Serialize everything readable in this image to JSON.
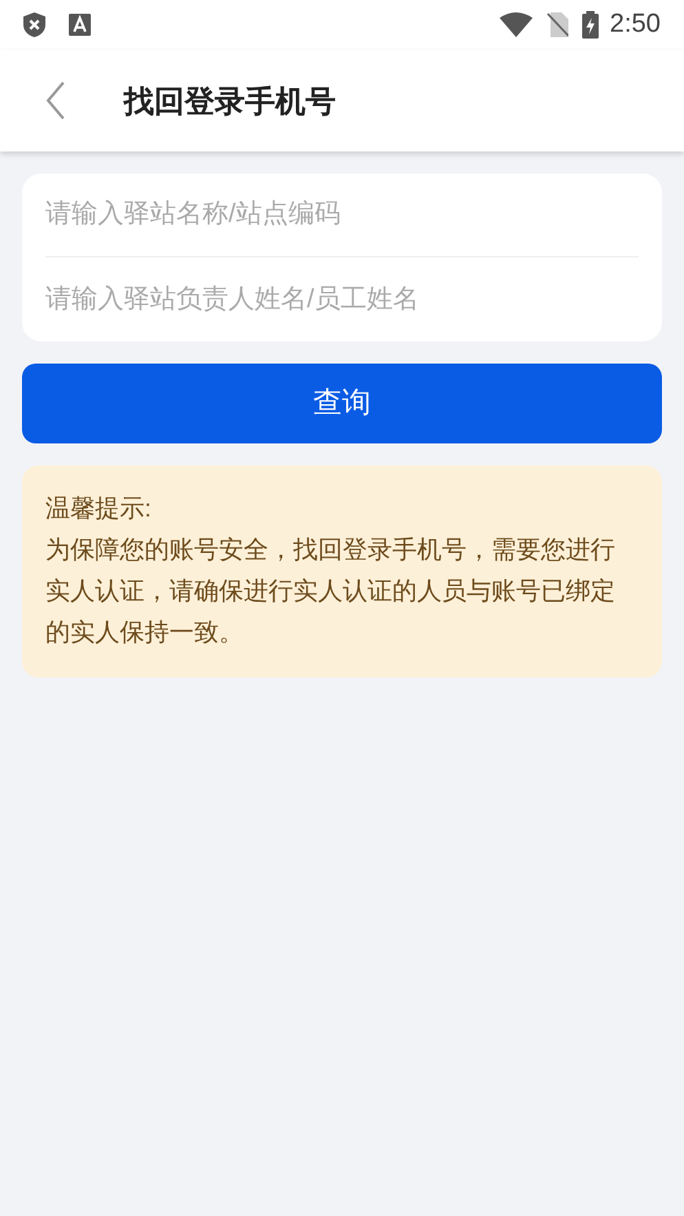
{
  "status_bar": {
    "time": "2:50"
  },
  "header": {
    "title": "找回登录手机号"
  },
  "form": {
    "fields": [
      {
        "placeholder": "请输入驿站名称/站点编码"
      },
      {
        "placeholder": "请输入驿站负责人姓名/员工姓名"
      }
    ]
  },
  "query_button": {
    "label": "查询"
  },
  "tip": {
    "title": "温馨提示:",
    "body": "为保障您的账号安全，找回登录手机号，需要您进行实人认证，请确保进行实人认证的人员与账号已绑定的实人保持一致。"
  }
}
